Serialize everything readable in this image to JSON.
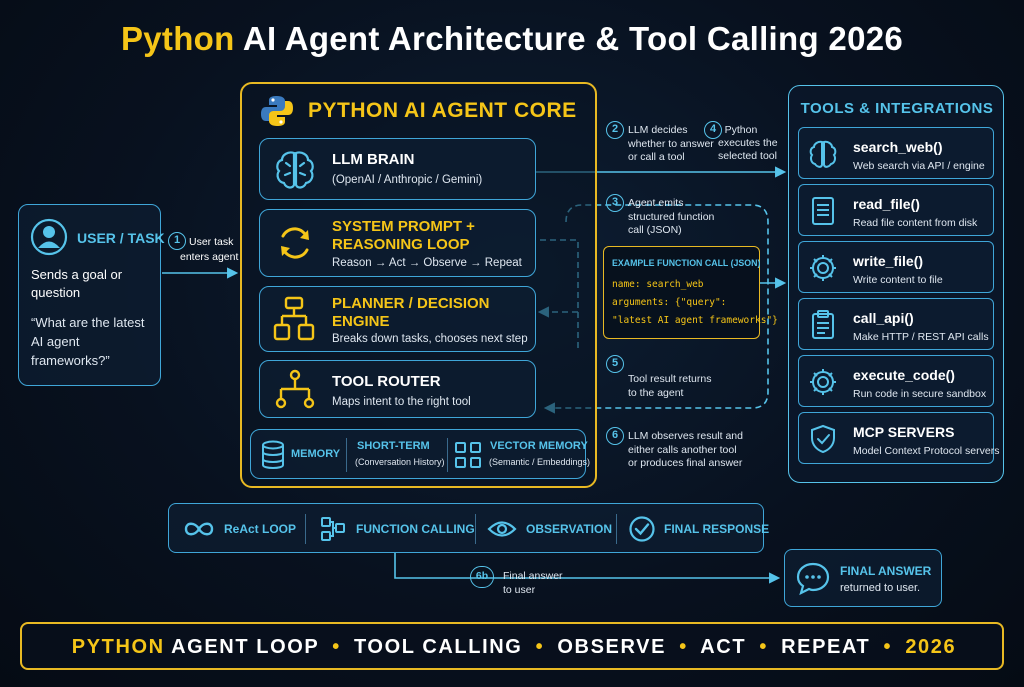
{
  "title": {
    "highlight": "Python",
    "rest": "AI Agent Architecture & Tool Calling 2026"
  },
  "user": {
    "header": "USER / TASK",
    "goal": [
      "Sends a goal or",
      "question"
    ],
    "quote": [
      "“What are the latest",
      "AI agent",
      "frameworks?”"
    ]
  },
  "steps": {
    "s1": {
      "num": "1",
      "lines": [
        "User task",
        "enters agent"
      ]
    },
    "s2": {
      "num": "2",
      "lines": [
        "LLM decides",
        "whether to answer",
        "or call a tool"
      ]
    },
    "s3": {
      "num": "3",
      "lines": [
        "Agent emits",
        "structured function",
        "call (JSON)"
      ]
    },
    "s4": {
      "num": "4",
      "lines": [
        "Python",
        "executes the",
        "selected tool"
      ]
    },
    "s5": {
      "num": "5",
      "lines": [
        "Tool result returns",
        "to the agent"
      ]
    },
    "s6": {
      "num": "6",
      "lines": [
        "LLM observes result and",
        "either calls another tool",
        "or produces final answer"
      ]
    },
    "s6b": {
      "num": "6b",
      "lines": [
        "Final answer",
        "to user"
      ]
    }
  },
  "core": {
    "title": "PYTHON AI AGENT CORE",
    "llm": {
      "name": "LLM BRAIN",
      "desc": "(OpenAI / Anthropic / Gemini)"
    },
    "prompt": {
      "name": [
        "SYSTEM PROMPT +",
        "REASONING LOOP"
      ],
      "desc": "Reason → Act → Observe → Repeat"
    },
    "planner": {
      "name": [
        "PLANNER / DECISION",
        "ENGINE"
      ],
      "desc": "Breaks down tasks, chooses next step"
    },
    "router": {
      "name": "TOOL ROUTER",
      "desc": "Maps intent to the right tool"
    },
    "memory": {
      "label": "MEMORY",
      "short_title": "SHORT-TERM",
      "short_desc": "(Conversation History)",
      "vector_title": "VECTOR MEMORY",
      "vector_desc": "(Semantic / Embeddings)"
    }
  },
  "example": {
    "title": "EXAMPLE FUNCTION CALL (JSON)",
    "line1": "name: search_web",
    "line2": "arguments: {\"query\":",
    "line3": "\"latest AI agent frameworks\"}"
  },
  "tools": {
    "header": "TOOLS & INTEGRATIONS",
    "items": [
      {
        "name": "search_web()",
        "desc": "Web search via API / engine",
        "icon": "brain-icon"
      },
      {
        "name": "read_file()",
        "desc": "Read file content from disk",
        "icon": "document-icon"
      },
      {
        "name": "write_file()",
        "desc": "Write content to file",
        "icon": "gear-icon"
      },
      {
        "name": "call_api()",
        "desc": "Make HTTP / REST API calls",
        "icon": "clipboard-icon"
      },
      {
        "name": "execute_code()",
        "desc": "Run code in secure sandbox",
        "icon": "gear-icon"
      },
      {
        "name": "MCP SERVERS",
        "desc": "Model Context Protocol servers",
        "icon": "shield-check-icon"
      }
    ]
  },
  "loop": {
    "items": [
      "ReAct LOOP",
      "FUNCTION CALLING",
      "OBSERVATION",
      "FINAL RESPONSE"
    ]
  },
  "final": {
    "title": "FINAL ANSWER",
    "desc": "returned to user."
  },
  "bottom": {
    "p1": "PYTHON",
    "p2": "AGENT LOOP",
    "p3": "TOOL CALLING",
    "p4": "OBSERVE",
    "p5": "ACT",
    "p6": "REPEAT",
    "p7": "2026"
  },
  "colors": {
    "gold": "#f5c518",
    "cyan": "#56c3ea",
    "blue_border": "#3fa6d8",
    "background": "#08111f"
  }
}
